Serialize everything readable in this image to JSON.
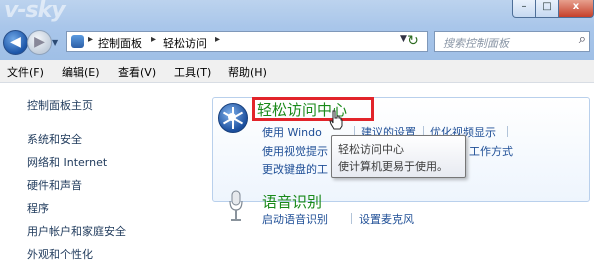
{
  "window": {
    "watermark": "v-sky",
    "min_glyph": "–",
    "max_glyph": "□",
    "close_glyph": "x"
  },
  "addressbar": {
    "back_glyph": "◀",
    "fwd_glyph": "▶",
    "crumbs": [
      "控制面板",
      "轻松访问"
    ],
    "separator": "▸",
    "refresh_glyph": "↻",
    "search_placeholder": "搜索控制面板",
    "search_icon": "search-icon"
  },
  "menubar": {
    "items": [
      "文件(F)",
      "编辑(E)",
      "查看(V)",
      "工具(T)",
      "帮助(H)"
    ]
  },
  "sidebar": {
    "items": [
      "控制面板主页",
      "系统和安全",
      "网络和 Internet",
      "硬件和声音",
      "程序",
      "用户帐户和家庭安全",
      "外观和个性化"
    ]
  },
  "main": {
    "category1": {
      "icon": "ease-of-access-icon",
      "title": "轻松访问中心",
      "links_row1": [
        "使用 Windo",
        "建议的设置",
        "优化视频显示"
      ],
      "links_row2": [
        "使用视觉提示",
        "工作方式"
      ],
      "links_row3": [
        "更改键盘的工"
      ]
    },
    "tooltip": {
      "line1": "轻松访问中心",
      "line2": "使计算机更易于使用。"
    },
    "category2": {
      "icon": "microphone-icon",
      "title": "语音识别",
      "links": [
        "启动语音识别",
        "设置麦克风"
      ]
    }
  },
  "colors": {
    "category_title": "#1a8a1a",
    "link": "#1e4e96",
    "highlight_box": "#e2242a"
  }
}
